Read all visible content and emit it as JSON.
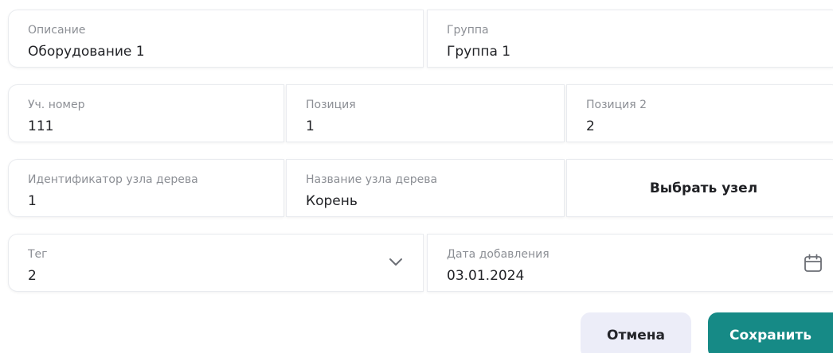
{
  "row1": {
    "description": {
      "label": "Описание",
      "value": "Оборудование 1"
    },
    "group": {
      "label": "Группа",
      "value": "Группа 1"
    }
  },
  "row2": {
    "acc_number": {
      "label": "Уч. номер",
      "value": "111"
    },
    "position": {
      "label": "Позиция",
      "value": "1"
    },
    "position2": {
      "label": "Позиция 2",
      "value": "2"
    }
  },
  "row3": {
    "node_id": {
      "label": "Идентификатор узла дерева",
      "value": "1"
    },
    "node_name": {
      "label": "Название узла дерева",
      "value": "Корень"
    },
    "pick_button": "Выбрать узел"
  },
  "row4": {
    "tag": {
      "label": "Тег",
      "value": "2",
      "icon": "chevron-down-icon"
    },
    "date_added": {
      "label": "Дата добавления",
      "value": "03.01.2024",
      "icon": "calendar-icon"
    }
  },
  "actions": {
    "cancel": "Отмена",
    "save": "Сохранить"
  },
  "colors": {
    "primary": "#168a86",
    "cancel_bg": "#ecedf8",
    "label": "#8c8f95",
    "text": "#222327",
    "border": "#e9ebef"
  }
}
